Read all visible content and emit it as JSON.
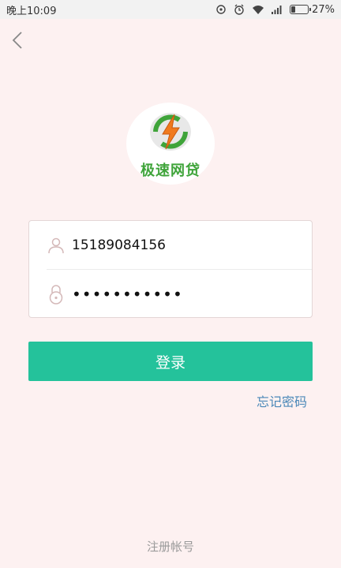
{
  "status_bar": {
    "time": "晚上10:09",
    "battery": "27%",
    "battery_level": 0.27
  },
  "logo": {
    "text": "极速网贷",
    "colors": {
      "green": "#3fa43a",
      "orange": "#f07a1e"
    }
  },
  "login": {
    "username_value": "15189084156",
    "password_value": "wwwwwwwwwww",
    "login_label": "登录",
    "forgot_label": "忘记密码",
    "register_label": "注册帐号"
  },
  "colors": {
    "background": "#fdf1f1",
    "accent": "#24c29b",
    "link": "#4a88b8"
  },
  "icons": [
    "back-chevron-icon",
    "user-icon",
    "lock-icon",
    "alarm-icon",
    "clock-icon",
    "wifi-icon",
    "signal-icon",
    "battery-icon"
  ]
}
